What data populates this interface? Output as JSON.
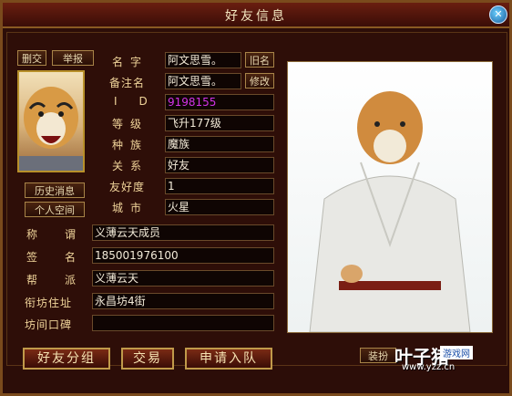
{
  "window": {
    "title": "好友信息"
  },
  "left_buttons": {
    "delete": "删交",
    "report": "举报",
    "history": "历史消息",
    "personal_space": "个人空间"
  },
  "info": {
    "name_label": "名字",
    "name_value": "阿文思雪。",
    "old_name_button": "旧名",
    "remark_label": "备注名",
    "remark_value": "阿文思雪。",
    "modify_button": "修改",
    "id_label": "ID",
    "id_value": "9198155",
    "level_label": "等级",
    "level_value": "飞升177级",
    "race_label": "种族",
    "race_value": "魔族",
    "relation_label": "关系",
    "relation_value": "好友",
    "friendship_label": "友好度",
    "friendship_value": "1",
    "city_label": "城市",
    "city_value": "火星"
  },
  "extra": {
    "title_label": "称谓",
    "title_value": "义薄云天成员",
    "signature_label": "签名",
    "signature_value": "185001976100",
    "guild_label": "帮派",
    "guild_value": "义薄云天",
    "address_label": "衔坊住址",
    "address_value": "永昌坊4街",
    "reputation_label": "坊间口碑",
    "reputation_value": ""
  },
  "bottom": {
    "friend_group": "好友分组",
    "trade": "交易",
    "join_team": "申请入队",
    "equip": "装扮"
  },
  "watermark": {
    "brand": "叶子猪",
    "tag": "游戏网",
    "url": "www.yzz.cn"
  },
  "colors": {
    "id_value": "#d233e8",
    "label": "#f0d49a"
  }
}
